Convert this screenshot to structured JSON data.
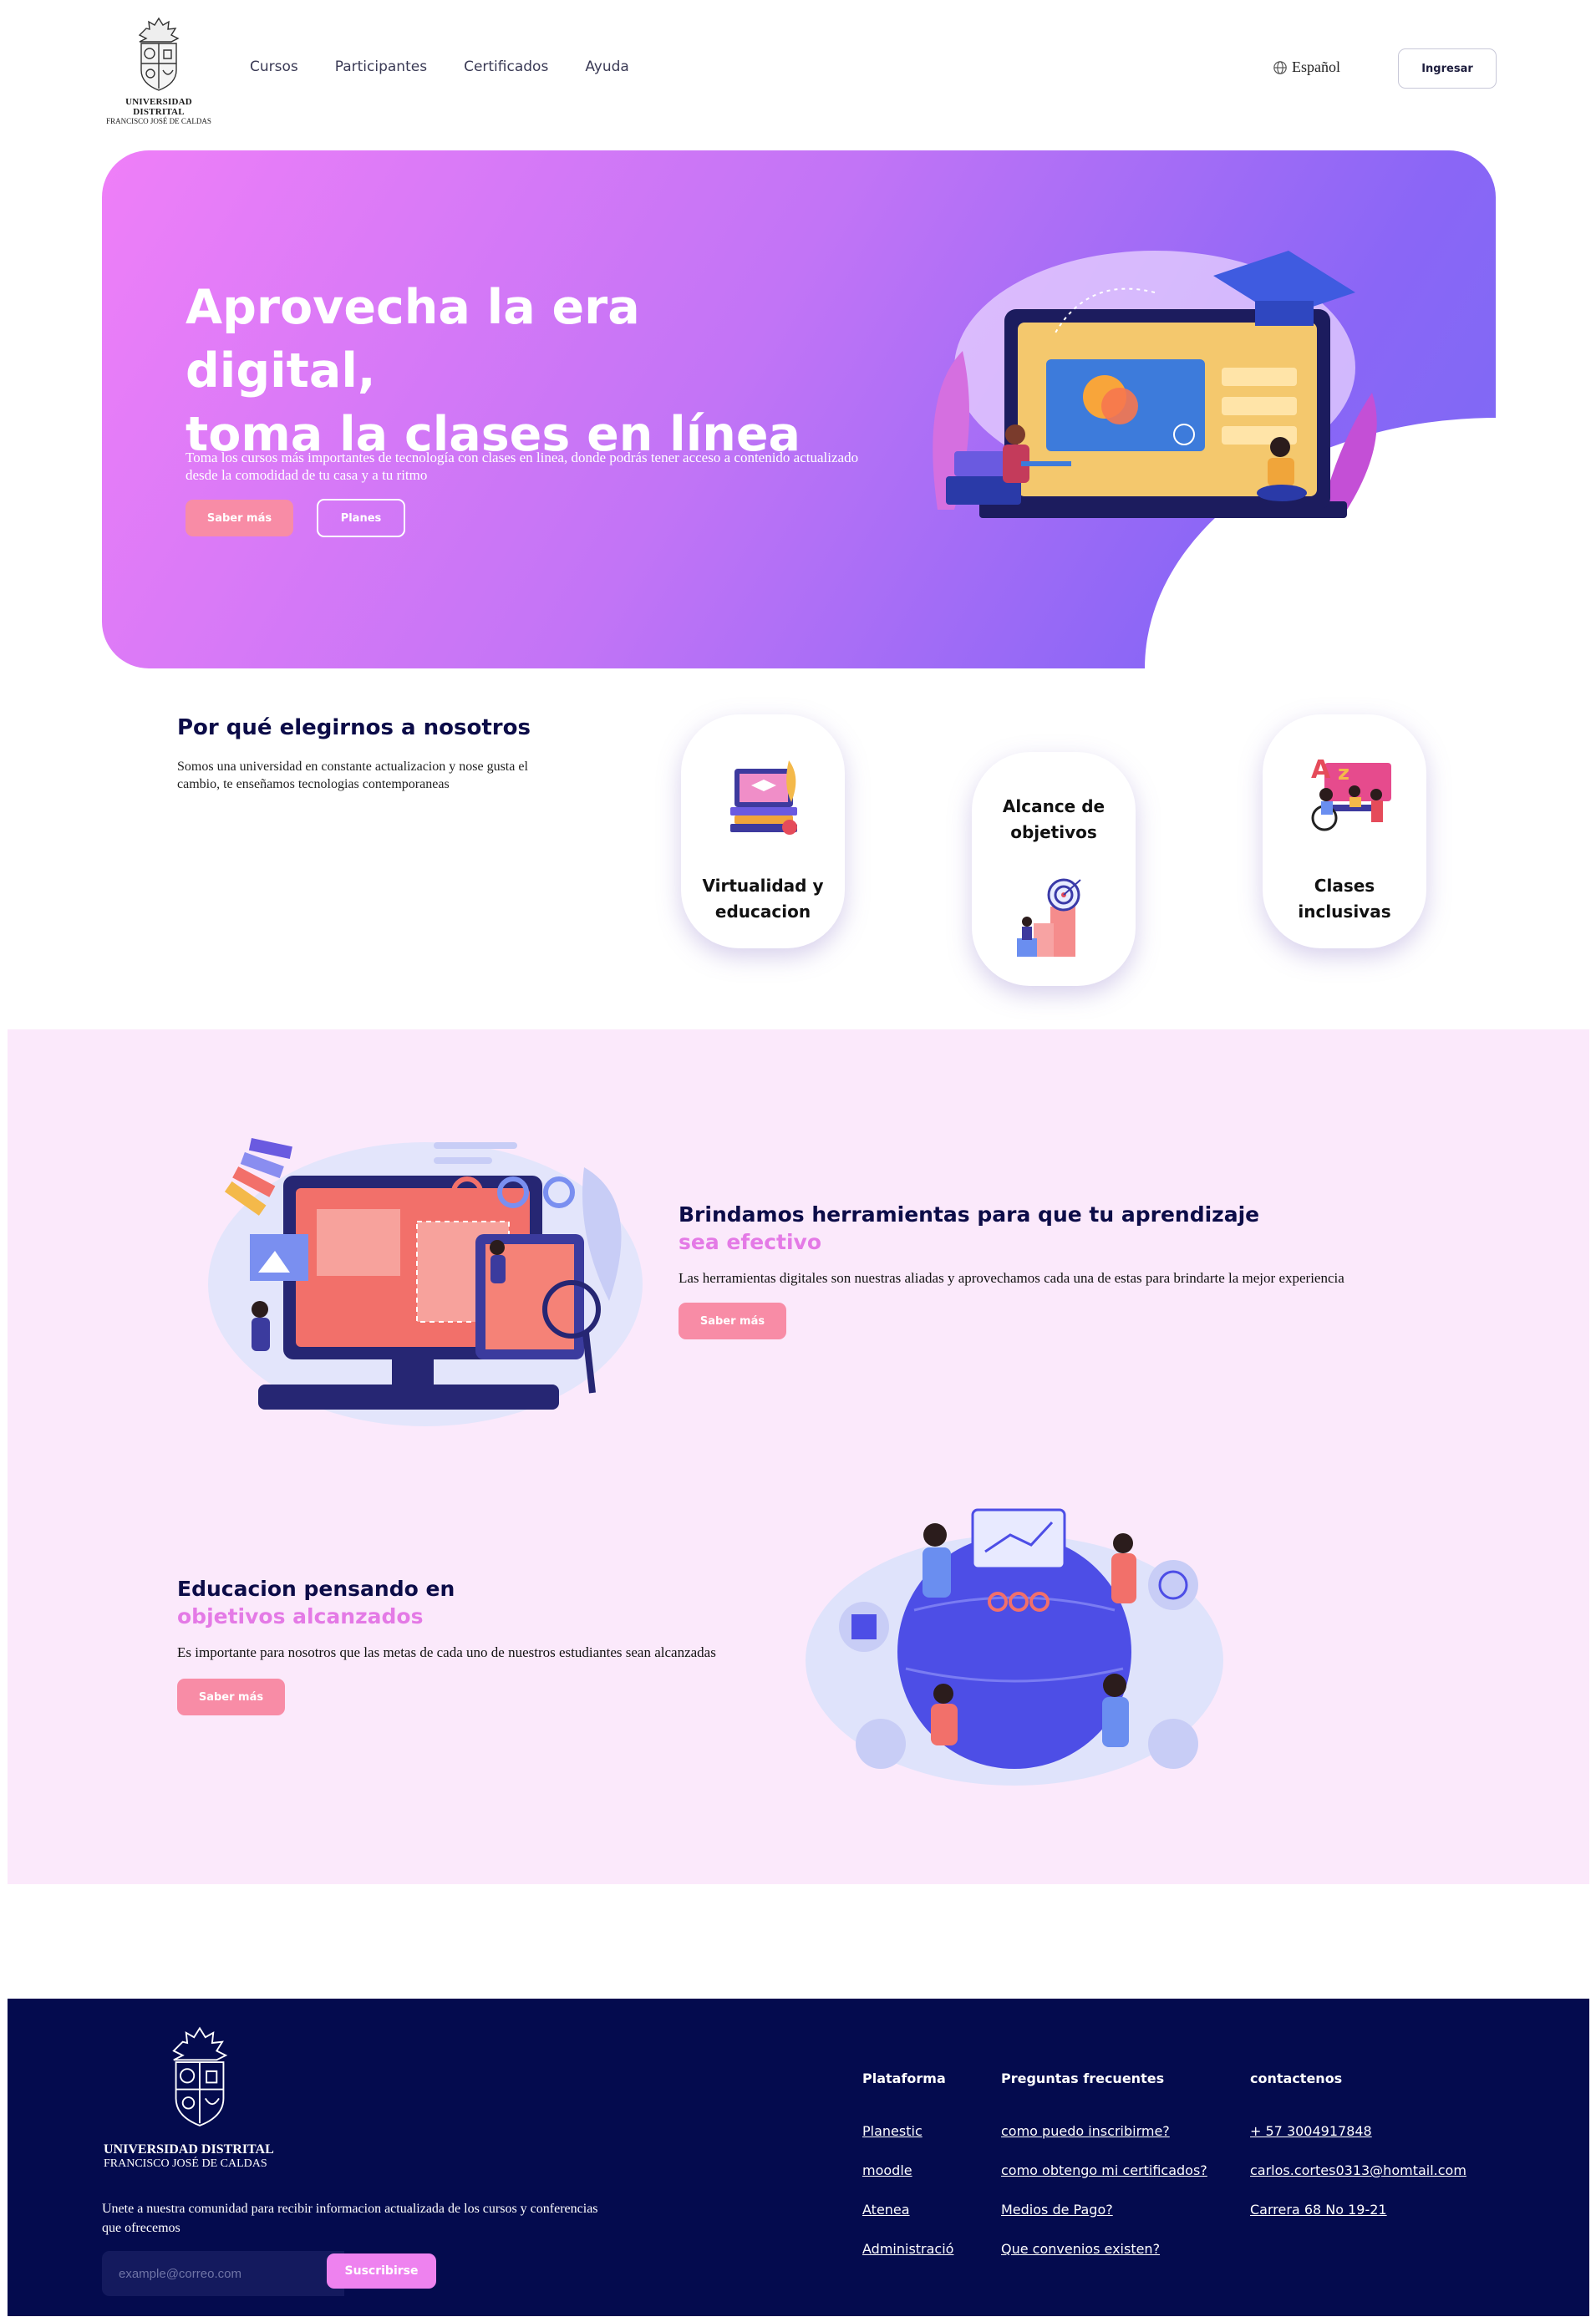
{
  "header": {
    "logo_line1": "UNIVERSIDAD DISTRITAL",
    "logo_line2": "FRANCISCO JOSÉ DE CALDAS",
    "nav": [
      "Cursos",
      "Participantes",
      "Certificados",
      "Ayuda"
    ],
    "language": "Español",
    "login_label": "Ingresar"
  },
  "hero": {
    "title_line1": "Aprovecha la era digital,",
    "title_line2": "toma la clases en línea",
    "description": "Toma los cursos más importantes de tecnología con clases en linea, donde podrás tener acceso a contenido actualizado desde la comodidad de tu casa y a tu ritmo",
    "btn_more": "Saber más",
    "btn_plans": "Planes"
  },
  "why": {
    "title": "Por qué elegirnos a nosotros",
    "text": "Somos una universidad en constante actualizacion y nose gusta el cambio, te enseñamos tecnologias contemporaneas",
    "cards": [
      {
        "line1": "Virtualidad y",
        "line2": "educacion"
      },
      {
        "line1": "Alcance de",
        "line2": "objetivos"
      },
      {
        "line1": "Clases",
        "line2": "inclusivas"
      }
    ]
  },
  "features": [
    {
      "title": "Brindamos herramientas para que tu aprendizaje",
      "accent": "sea efectivo",
      "text": "Las herramientas digitales son nuestras aliadas y aprovechamos cada una de estas para brindarte la mejor experiencia",
      "button": "Saber más"
    },
    {
      "title": "Educacion pensando en",
      "accent": "objetivos alcanzados",
      "text": "Es importante para nosotros que las metas de cada uno de nuestros estudiantes sean alcanzadas",
      "button": "Saber más"
    }
  ],
  "footer": {
    "logo_line1": "UNIVERSIDAD DISTRITAL",
    "logo_line2": "FRANCISCO JOSÉ DE CALDAS",
    "newsletter_text": "Unete a nuestra comunidad para recibir informacion actualizada de los cursos y conferencias que ofrecemos",
    "email_placeholder": "example@correo.com",
    "subscribe_label": "Suscribirse",
    "columns": [
      {
        "title": "Plataforma",
        "links": [
          "Planestic",
          "moodle",
          "Atenea",
          "Administració"
        ]
      },
      {
        "title": "Preguntas frecuentes",
        "links": [
          "como puedo inscribirme?",
          "como obtengo mi certificados?",
          "Medios de Pago?",
          "Que convenios existen?"
        ]
      },
      {
        "title": "contactenos",
        "links": [
          "+ 57 3004917848",
          "carlos.cortes0313@homtail.com",
          "Carrera 68 No 19-21"
        ]
      }
    ]
  },
  "colors": {
    "brand_pink": "#f88ca6",
    "accent_purple": "#e47ae6",
    "navy": "#040b4e",
    "band_bg": "#fbe9fb"
  }
}
